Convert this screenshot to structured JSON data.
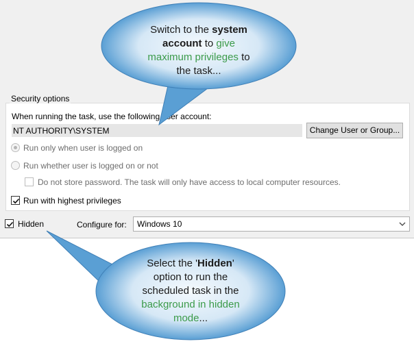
{
  "security": {
    "legend": "Security options",
    "run_as_label": "When running the task, use the following user account:",
    "account": "NT AUTHORITY\\SYSTEM",
    "change_button": "Change User or Group...",
    "radio_logged_on": "Run only when user is logged on",
    "radio_whether": "Run whether user is logged on or not",
    "no_store_password": "Do not store password.  The task will only have access to local computer resources.",
    "highest_privileges": "Run with highest privileges"
  },
  "bottom": {
    "hidden_label": "Hidden",
    "configure_label": "Configure for:",
    "configure_value": "Windows 10"
  },
  "callout_top": {
    "line1": "Switch to the ",
    "bold1": "system",
    "bold2": "account",
    "mid": " to ",
    "green1": "give",
    "green2": "maximum privileges",
    "tail": " to",
    "line4": "the task..."
  },
  "callout_bottom": {
    "pre": "Select the '",
    "bold": "Hidden",
    "post": "'",
    "line2": "option to run the",
    "line3": "scheduled task in the",
    "green1": "background in hidden",
    "green2": "mode",
    "ellipsis": "..."
  },
  "colors": {
    "callout_fill": "#5a9fd4",
    "callout_highlight": "#f4f9fd",
    "accent_green": "#3c9b4a"
  }
}
